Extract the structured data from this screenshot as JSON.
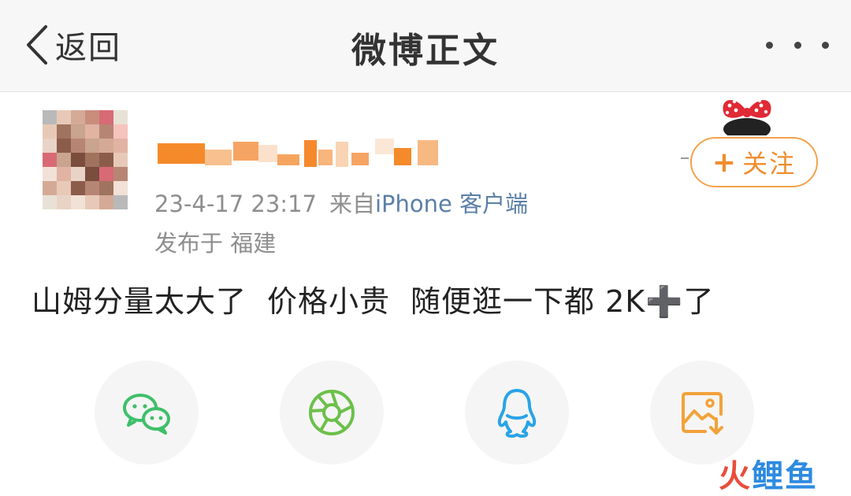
{
  "nav": {
    "back_label": "返回",
    "title": "微博正文"
  },
  "post": {
    "timestamp": "23-4-17 23:17",
    "from_prefix": "来自",
    "source": "iPhone 客户端",
    "location": "发布于 福建",
    "follow_label": "关注",
    "text_parts": [
      "山姆分量太大了",
      "价格小贵",
      "随便逛一下都 2K",
      "➕",
      "了"
    ]
  },
  "share": {
    "items": [
      "wechat-icon",
      "moments-icon",
      "qq-icon",
      "save-image-icon"
    ]
  },
  "colors": {
    "accent_orange": "#f08d2e",
    "source_blue": "#5b7fa6",
    "wechat_green": "#3fbf6a",
    "moments_green": "#6cc04a",
    "qq_blue": "#2aa4e6",
    "save_orange": "#f2a23a"
  },
  "watermark": {
    "part1": "火",
    "part2": "鲤",
    "part3": "鱼"
  }
}
